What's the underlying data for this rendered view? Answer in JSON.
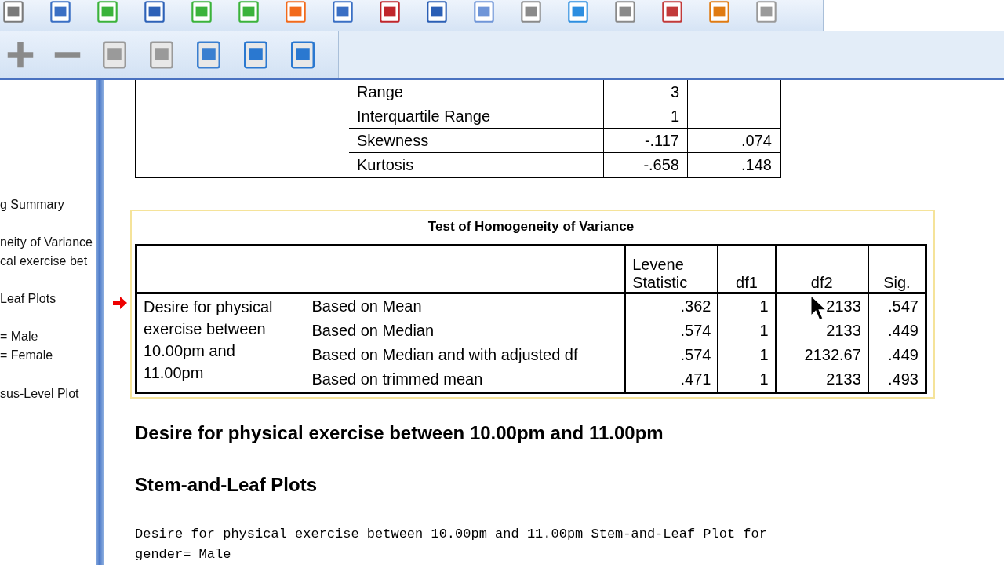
{
  "outline": {
    "items": [
      "g Summary",
      "neity of Variance",
      "cal exercise bet",
      "Leaf Plots",
      "= Male",
      "= Female",
      "sus-Level Plot"
    ]
  },
  "descriptives": {
    "rows": [
      {
        "label": "Range",
        "statistic": "3"
      },
      {
        "label": "Interquartile Range",
        "statistic": "1"
      },
      {
        "label": "Skewness",
        "statistic": "-.117",
        "std_error": ".074"
      },
      {
        "label": "Kurtosis",
        "statistic": "-.658",
        "std_error": ".148"
      }
    ]
  },
  "homogeneity": {
    "title": "Test of Homogeneity of Variance",
    "columns": [
      "Levene Statistic",
      "df1",
      "df2",
      "Sig."
    ],
    "variable": "Desire for physical exercise between 10.00pm and 11.00pm",
    "rows": [
      {
        "method": "Based on Mean",
        "levene": ".362",
        "df1": "1",
        "df2": "2133",
        "sig": ".547",
        "selected": true
      },
      {
        "method": "Based on Median",
        "levene": ".574",
        "df1": "1",
        "df2": "2133",
        "sig": ".449",
        "selected": false
      },
      {
        "method": "Based on Median and with adjusted df",
        "levene": ".574",
        "df1": "1",
        "df2": "2132.67",
        "sig": ".449",
        "selected": false
      },
      {
        "method": "Based on trimmed mean",
        "levene": ".471",
        "df1": "1",
        "df2": "2133",
        "sig": ".493",
        "selected": false
      }
    ]
  },
  "headings": [
    "Desire for physical exercise between 10.00pm and 11.00pm",
    "Stem-and-Leaf Plots"
  ],
  "plot_text": [
    "Desire for physical exercise between 10.00pm and 11.00pm Stem-and-Leaf Plot for",
    "gender= Male"
  ]
}
